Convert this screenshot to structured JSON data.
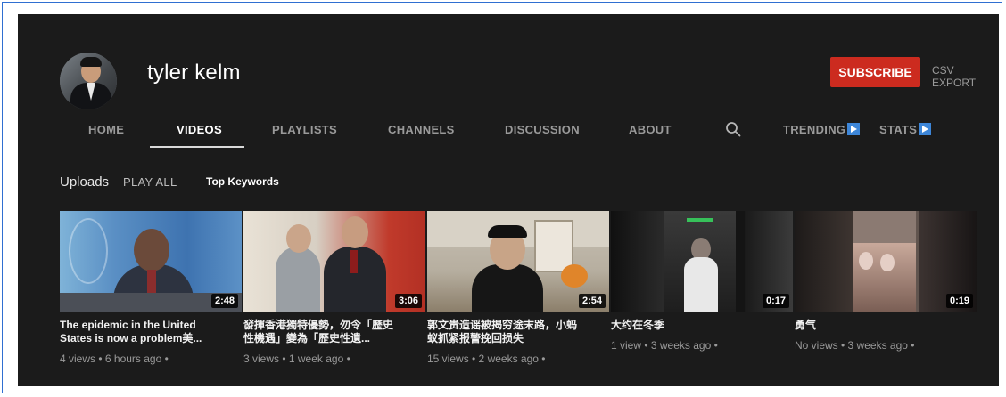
{
  "channel": {
    "name": "tyler kelm"
  },
  "header": {
    "subscribe_label": "SUBSCRIBE",
    "csv_label": "CSV EXPORT"
  },
  "nav": {
    "home": "HOME",
    "videos": "VIDEOS",
    "playlists": "PLAYLISTS",
    "channels": "CHANNELS",
    "discussion": "DISCUSSION",
    "about": "ABOUT",
    "trending": "TRENDING",
    "stats": "STATS",
    "search_icon": "search-icon",
    "active": "VIDEOS"
  },
  "uploads": {
    "title": "Uploads",
    "play_all": "PLAY ALL",
    "top_keywords": "Top Keywords"
  },
  "videos": [
    {
      "title": "The epidemic in the United States is now a problem美...",
      "duration": "2:48",
      "meta": "4 views • 6 hours ago •"
    },
    {
      "title": "發揮香港獨特優勢，勿令「歷史性機遇」變為「歷史性遺...",
      "duration": "3:06",
      "meta": "3 views • 1 week ago •"
    },
    {
      "title": "郭文贵造谣被揭穷途末路，小蚂蚁抓紧报警挽回损失",
      "duration": "2:54",
      "meta": "15 views • 2 weeks ago •"
    },
    {
      "title": "大约在冬季",
      "duration": "0:17",
      "meta": "1 view • 3 weeks ago •"
    },
    {
      "title": "勇气",
      "duration": "0:19",
      "meta": "No views • 3 weeks ago •"
    }
  ],
  "colors": {
    "background": "#1b1b1b",
    "subscribe": "#cc2b1f",
    "extension_icon": "#3d86d8",
    "frame_border": "#2f6fd1"
  }
}
